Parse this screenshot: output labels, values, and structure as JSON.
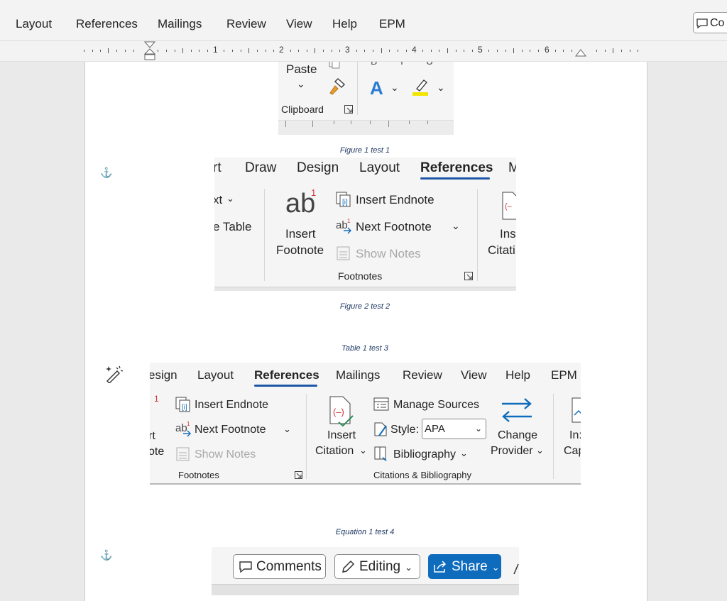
{
  "menu": {
    "items": [
      "Layout",
      "References",
      "Mailings",
      "Review",
      "View",
      "Help",
      "EPM"
    ],
    "comments_partial": "Co"
  },
  "ruler": {
    "numbers": [
      "1",
      "2",
      "3",
      "4",
      "5",
      "6"
    ]
  },
  "figure1": {
    "paste": "Paste",
    "group": "Clipboard",
    "caption": "Figure 1 test 1"
  },
  "figure2": {
    "tabs": [
      "rt",
      "Draw",
      "Design",
      "Layout",
      "References",
      "M"
    ],
    "left_partial_1": "xt",
    "left_partial_2": "e Table",
    "ab": "ab",
    "sup": "1",
    "insert_footnote_1": "Insert",
    "insert_footnote_2": "Footnote",
    "insert_endnote": "Insert Endnote",
    "next_footnote": "Next Footnote",
    "show_notes": "Show Notes",
    "group": "Footnotes",
    "right_partial_1": "Ins",
    "right_partial_2": "Citati",
    "caption": "Figure 2 test 2"
  },
  "table_caption": "Table 1 test 3",
  "figure3": {
    "tabs": [
      "esign",
      "Layout",
      "References",
      "Mailings",
      "Review",
      "View",
      "Help",
      "EPM"
    ],
    "left_partial_1": "rt",
    "left_partial_2": "ote",
    "sup": "1",
    "insert_endnote": "Insert Endnote",
    "next_footnote": "Next Footnote",
    "show_notes": "Show Notes",
    "footnotes_group": "Footnotes",
    "insert_citation_1": "Insert",
    "insert_citation_2": "Citation",
    "manage_sources": "Manage Sources",
    "style_label": "Style:",
    "style_value": "APA",
    "bibliography": "Bibliography",
    "change_provider_1": "Change",
    "change_provider_2": "Provider",
    "right_partial_1": "In:",
    "right_partial_2": "Cap",
    "citations_group": "Citations & Bibliography"
  },
  "equation_caption": "Equation 1 test 4",
  "figure4": {
    "comments": "Comments",
    "editing": "Editing",
    "share": "Share"
  }
}
